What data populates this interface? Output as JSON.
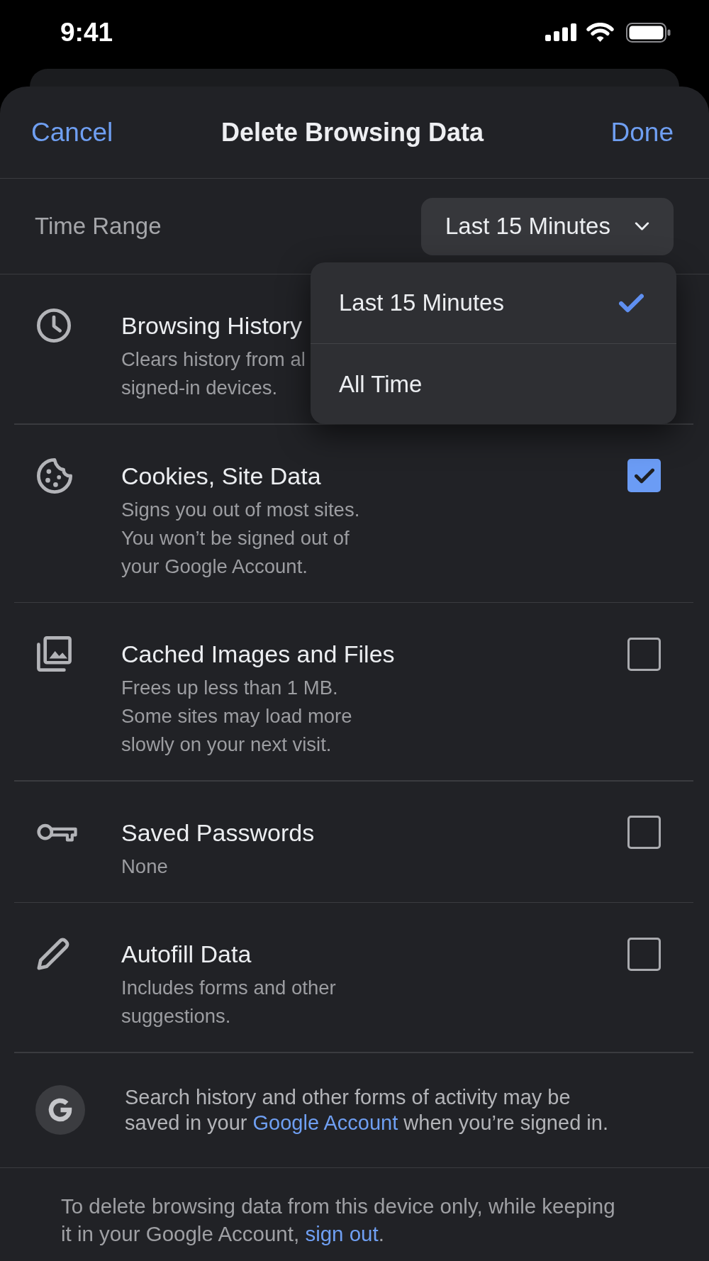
{
  "status_bar": {
    "time": "9:41"
  },
  "header": {
    "cancel": "Cancel",
    "title": "Delete Browsing Data",
    "done": "Done"
  },
  "time_range": {
    "label": "Time Range",
    "value": "Last 15 Minutes",
    "expanded": true,
    "options": [
      {
        "label": "Last 15 Minutes",
        "selected": true
      },
      {
        "label": "All Time",
        "selected": false
      }
    ]
  },
  "items": [
    {
      "kind": "history",
      "title": "Browsing History",
      "description": "Clears history from al\nsigned-in devices."
    },
    {
      "kind": "cookies",
      "title": "Cookies, Site Data",
      "description": "Signs you out of most sites.\nYou won’t be signed out of\nyour Google Account.",
      "checked": true
    },
    {
      "kind": "cache",
      "title": "Cached Images and Files",
      "description": "Frees up less than 1 MB.\nSome sites may load more\nslowly on your next visit.",
      "checked": false
    },
    {
      "kind": "passwords",
      "title": "Saved Passwords",
      "description": "None",
      "checked": false
    },
    {
      "kind": "autofill",
      "title": "Autofill Data",
      "description": "Includes forms and other\nsuggestions.",
      "checked": false
    }
  ],
  "account_notice": {
    "text_before": "Search history and other forms of activity may be\nsaved in your ",
    "link": "Google Account",
    "text_after": " when you’re signed in."
  },
  "footer": {
    "text_before": "To delete browsing data from this device only, while keeping\nit in your Google Account, ",
    "link": "sign out",
    "text_after": "."
  }
}
